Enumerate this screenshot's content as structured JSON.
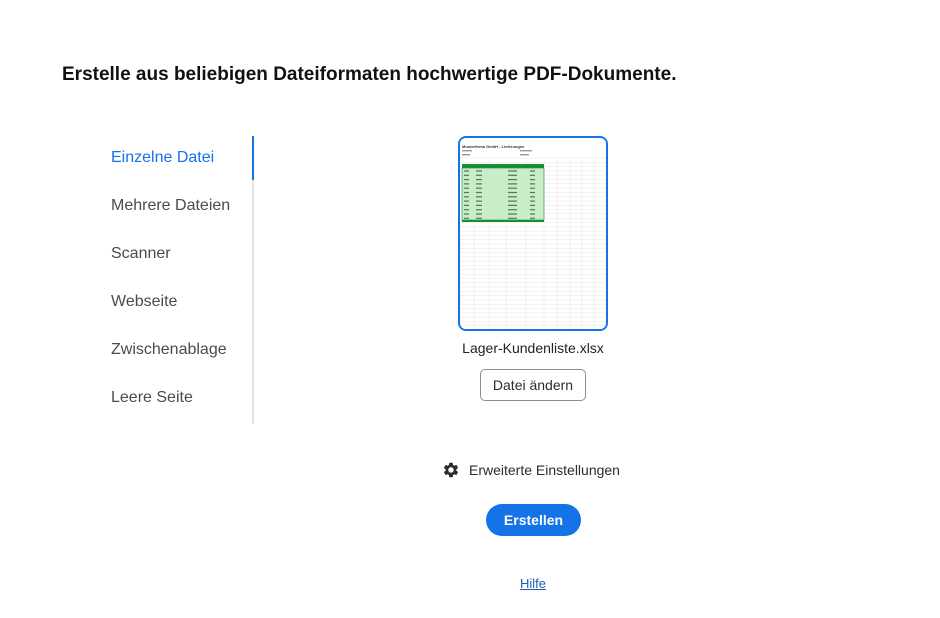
{
  "page": {
    "title": "Erstelle aus beliebigen Dateiformaten hochwertige PDF-Dokumente."
  },
  "sidebar": {
    "items": [
      {
        "label": "Einzelne Datei",
        "active": true
      },
      {
        "label": "Mehrere Dateien",
        "active": false
      },
      {
        "label": "Scanner",
        "active": false
      },
      {
        "label": "Webseite",
        "active": false
      },
      {
        "label": "Zwischenablage",
        "active": false
      },
      {
        "label": "Leere Seite",
        "active": false
      }
    ]
  },
  "file": {
    "name": "Lager-Kundenliste.xlsx",
    "change_label": "Datei ändern",
    "preview_title": "Musterfirma GmbH - Lieferungen"
  },
  "settings": {
    "label": "Erweiterte Einstellungen",
    "icon": "gear-icon"
  },
  "actions": {
    "create_label": "Erstellen",
    "help_label": "Hilfe"
  },
  "colors": {
    "accent": "#1473e6",
    "table_header": "#1d8a3a",
    "table_fill": "#c9ecc9"
  }
}
